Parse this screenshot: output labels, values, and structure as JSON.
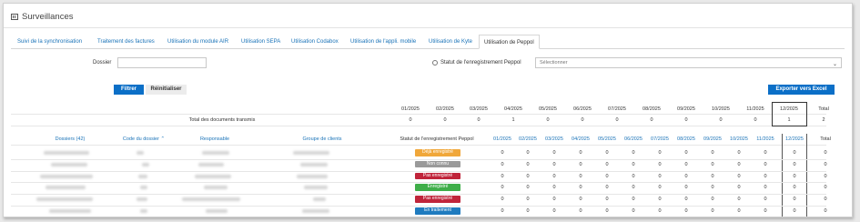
{
  "page": {
    "title": "Surveillances",
    "title_icon": "chart-icon"
  },
  "tabs": [
    {
      "label": "Suivi de la synchronisation",
      "active": false
    },
    {
      "label": "Traitement des factures",
      "active": false
    },
    {
      "label": "Utilisation du module AIR",
      "active": false
    },
    {
      "label": "Utilisation SEPA",
      "active": false
    },
    {
      "label": "Utilisation Codabox",
      "active": false
    },
    {
      "label": "Utilisation de l'appli. mobile",
      "active": false
    },
    {
      "label": "Utilisation de Kyte",
      "active": false
    },
    {
      "label": "Utilisation de Peppol",
      "active": true
    }
  ],
  "filters": {
    "dossier_label": "Dossier",
    "dossier_value": "",
    "status_label": "Statut de l'enregistrement Peppol",
    "status_placeholder": "Sélectionner"
  },
  "buttons": {
    "filter": "Filtrer",
    "reset": "Réinitialiser",
    "export": "Exporter vers Excel"
  },
  "months": [
    "01/2025",
    "02/2025",
    "03/2025",
    "04/2025",
    "05/2025",
    "06/2025",
    "07/2025",
    "08/2025",
    "09/2025",
    "10/2025",
    "11/2025",
    "12/2025"
  ],
  "total_label": "Total",
  "summary": {
    "label": "Total des documents transmis",
    "values": [
      "0",
      "0",
      "0",
      "1",
      "0",
      "0",
      "0",
      "0",
      "0",
      "0",
      "0",
      "1"
    ],
    "total": "2"
  },
  "columns": {
    "dossiers": "Dossiers (42)",
    "code": "Code du dossier",
    "responsable": "Responsable",
    "groupe": "Groupe de clients",
    "statut": "Statut de l'enregistrement Peppol",
    "sort_icon": "sort-ascending-icon"
  },
  "rows": [
    {
      "status": "Déjà enregistré",
      "color": "#f0a73a",
      "values": [
        "0",
        "0",
        "0",
        "0",
        "0",
        "0",
        "0",
        "0",
        "0",
        "0",
        "0",
        "0"
      ],
      "total": "0"
    },
    {
      "status": "Non connu",
      "color": "#9a9a9a",
      "values": [
        "0",
        "0",
        "0",
        "0",
        "0",
        "0",
        "0",
        "0",
        "0",
        "0",
        "0",
        "0"
      ],
      "total": "0"
    },
    {
      "status": "Pas enregistré",
      "color": "#c0243a",
      "values": [
        "0",
        "0",
        "0",
        "0",
        "0",
        "0",
        "0",
        "0",
        "0",
        "0",
        "0",
        "0"
      ],
      "total": "0"
    },
    {
      "status": "Enregistré",
      "color": "#3fae49",
      "values": [
        "0",
        "0",
        "0",
        "0",
        "0",
        "0",
        "0",
        "0",
        "0",
        "0",
        "0",
        "0"
      ],
      "total": "0"
    },
    {
      "status": "Pas enregistré",
      "color": "#c0243a",
      "values": [
        "0",
        "0",
        "0",
        "0",
        "0",
        "0",
        "0",
        "0",
        "0",
        "0",
        "0",
        "0"
      ],
      "total": "0"
    },
    {
      "status": "En traitement",
      "color": "#1f7bbf",
      "values": [
        "0",
        "0",
        "0",
        "0",
        "0",
        "0",
        "0",
        "0",
        "0",
        "0",
        "0",
        "0"
      ],
      "total": "0"
    }
  ]
}
